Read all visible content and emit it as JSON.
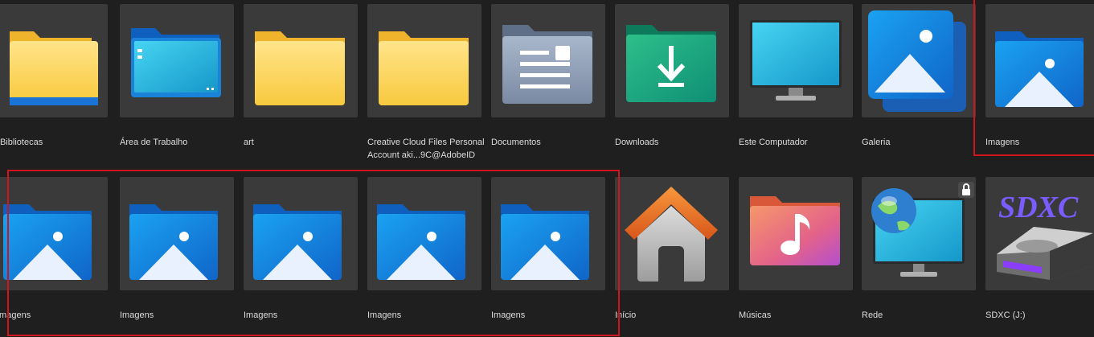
{
  "items": [
    {
      "label": "Bibliotecas",
      "icon": "library-folder-icon"
    },
    {
      "label": "Área de Trabalho",
      "icon": "desktop-folder-icon"
    },
    {
      "label": "art",
      "icon": "folder-icon"
    },
    {
      "label": "Creative Cloud Files Personal Account aki...9C@AdobeID",
      "icon": "folder-icon"
    },
    {
      "label": "Documentos",
      "icon": "documents-folder-icon"
    },
    {
      "label": "Downloads",
      "icon": "downloads-folder-icon"
    },
    {
      "label": "Este Computador",
      "icon": "computer-monitor-icon"
    },
    {
      "label": "Galeria",
      "icon": "gallery-icon"
    },
    {
      "label": "Imagens",
      "icon": "pictures-folder-icon"
    },
    {
      "label": "Imagens",
      "icon": "pictures-folder-icon"
    },
    {
      "label": "Imagens",
      "icon": "pictures-folder-icon"
    },
    {
      "label": "Imagens",
      "icon": "pictures-folder-icon"
    },
    {
      "label": "Imagens",
      "icon": "pictures-folder-icon"
    },
    {
      "label": "Imagens",
      "icon": "pictures-folder-icon"
    },
    {
      "label": "Início",
      "icon": "home-icon"
    },
    {
      "label": "Músicas",
      "icon": "music-folder-icon"
    },
    {
      "label": "Rede",
      "icon": "network-icon"
    },
    {
      "label": "SDXC (J:)",
      "icon": "sdxc-drive-icon"
    }
  ],
  "lock_icon": "lock-icon",
  "sdxc_badge_text": "SDXC",
  "colors": {
    "background": "#1f1f1f",
    "tile": "#3a3a3a",
    "selection": "#d0161c",
    "folder_yellow": "#fcd45c",
    "folder_blue": "#1a7fe0"
  }
}
